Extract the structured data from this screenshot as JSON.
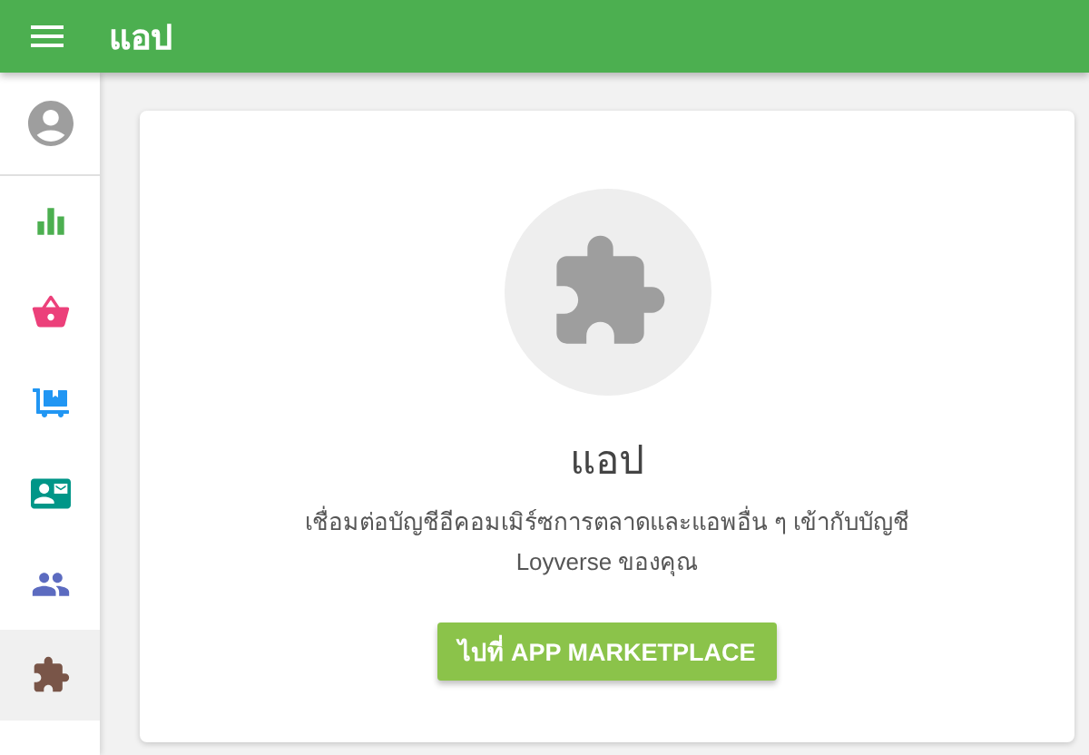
{
  "app_bar": {
    "title": "แอป"
  },
  "sidebar": {
    "items": [
      {
        "kind": "profile",
        "selected": false,
        "color": "#9e9e9e"
      },
      {
        "kind": "reports",
        "selected": false,
        "color": "#4caf50"
      },
      {
        "kind": "basket",
        "selected": false,
        "color": "#ec407a"
      },
      {
        "kind": "inventory",
        "selected": false,
        "color": "#2196f3"
      },
      {
        "kind": "employees",
        "selected": false,
        "color": "#009688"
      },
      {
        "kind": "customers",
        "selected": false,
        "color": "#5c6bc0"
      },
      {
        "kind": "apps",
        "selected": true,
        "color": "#795548"
      }
    ]
  },
  "card": {
    "title": "แอป",
    "description": "เชื่อมต่อบัญชีอีคอมเมิร์ซการตลาดและแอพอื่น ๆ เข้ากับบัญชี Loyverse ของคุณ",
    "button": "ไปที่ APP MARKETPLACE"
  }
}
